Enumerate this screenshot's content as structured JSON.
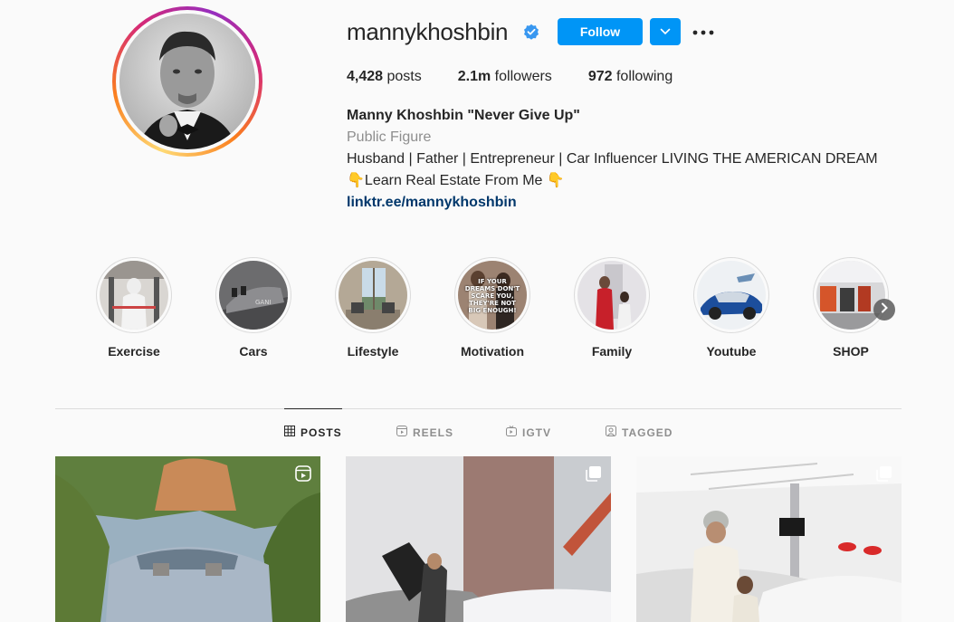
{
  "profile": {
    "username": "mannykhoshbin",
    "follow_label": "Follow",
    "stats": {
      "posts_count": "4,428",
      "posts_label": "posts",
      "followers_count": "2.1m",
      "followers_label": "followers",
      "following_count": "972",
      "following_label": "following"
    },
    "bio": {
      "name": "Manny Khoshbin \"Never Give Up\"",
      "category": "Public Figure",
      "line1": "Husband | Father | Entrepreneur | Car Influencer LIVING THE AMERICAN DREAM",
      "line2": "👇Learn Real Estate From Me 👇",
      "link": "linktr.ee/mannykhoshbin"
    }
  },
  "highlights": [
    {
      "label": "Exercise"
    },
    {
      "label": "Cars"
    },
    {
      "label": "Lifestyle"
    },
    {
      "label": "Motivation",
      "image_text": "IF YOUR DREAMS DON'T SCARE YOU, THEY'RE NOT BIG ENOUGH!"
    },
    {
      "label": "Family"
    },
    {
      "label": "Youtube"
    },
    {
      "label": "SHOP"
    }
  ],
  "tabs": [
    {
      "label": "POSTS",
      "active": true
    },
    {
      "label": "REELS",
      "active": false
    },
    {
      "label": "IGTV",
      "active": false
    },
    {
      "label": "TAGGED",
      "active": false
    }
  ],
  "colors": {
    "accent": "#0095f6",
    "link": "#00376b",
    "muted": "#8e8e8e",
    "verified": "#3897f0"
  },
  "icons": {
    "verified": "verified-badge-icon",
    "dropdown": "chevron-down-icon",
    "more": "more-horizontal-icon",
    "next": "chevron-right-icon",
    "posts": "grid-icon",
    "reels": "reels-icon",
    "igtv": "igtv-icon",
    "tagged": "tagged-icon",
    "post_badges": [
      "reel-icon",
      "carousel-icon",
      "carousel-icon"
    ]
  }
}
